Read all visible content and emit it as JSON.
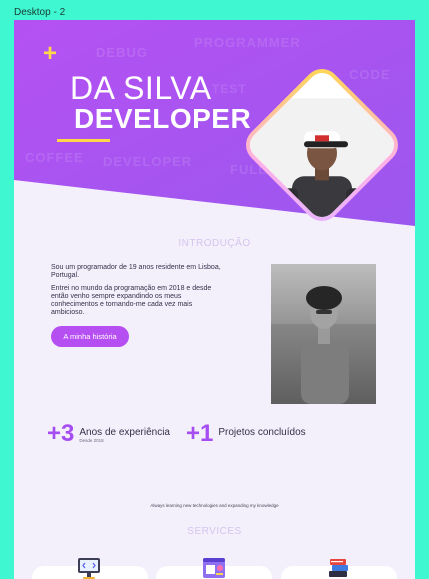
{
  "frame": {
    "label": "Desktop - 2"
  },
  "hero": {
    "title_line1": "DA SILVA",
    "title_line2": "DEVELOPER",
    "background_words": [
      "DEBUG",
      "PROGRAMMER",
      "TEST",
      "CODE",
      "COFFEE",
      "DEVELOPER",
      "FULLSTACK"
    ],
    "colors": {
      "gradient_start": "#b551f3",
      "gradient_end": "#9b57ee",
      "accent": "#ffd84a"
    }
  },
  "intro": {
    "title": "INTRODUÇÃO",
    "paragraph1": "Sou um programador de 19 anos residente em Lisboa, Portugal.",
    "paragraph2": "Entrei no mundo da programação em 2018 e desde então venho sempre expandindo os meus conhecimentos e tornando-me cada vez mais ambicioso.",
    "button_label": "A minha história"
  },
  "stats": [
    {
      "number": "+3",
      "label": "Anos de experiência",
      "sub": "Desde 2018"
    },
    {
      "number": "+1",
      "label": "Projetos concluídos",
      "sub": ""
    }
  ],
  "tagline": "Always learning new technologies and expanding my knowledge",
  "services": {
    "title": "SERVICES",
    "cards": [
      {
        "icon": "monitor-code-icon"
      },
      {
        "icon": "design-tools-icon"
      },
      {
        "icon": "books-icon"
      }
    ]
  }
}
